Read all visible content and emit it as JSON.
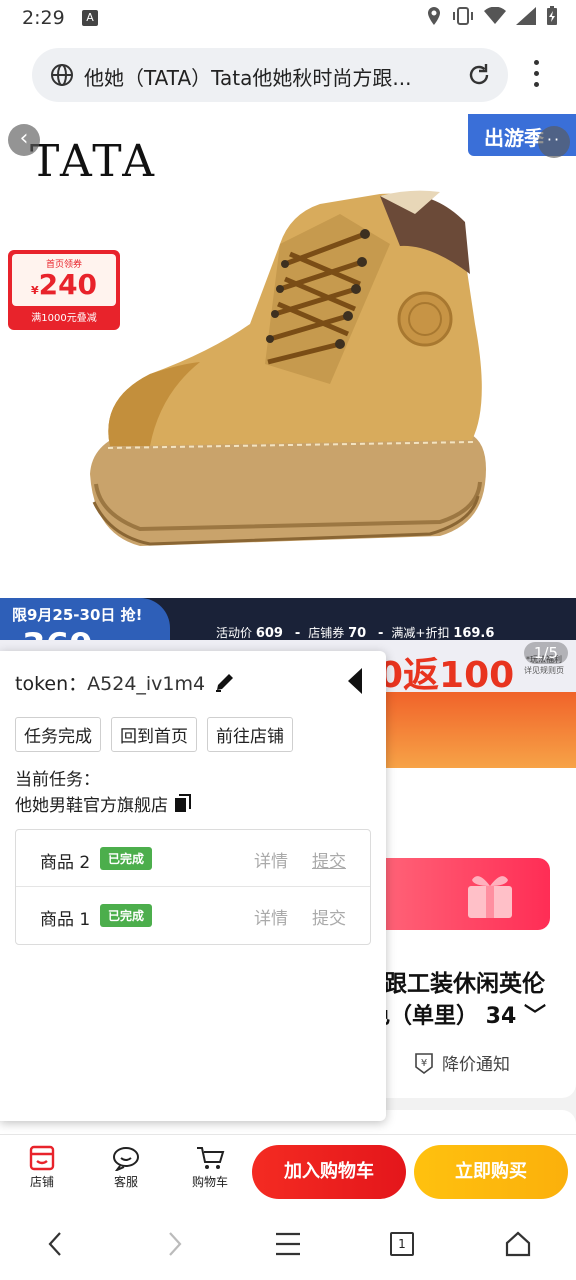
{
  "status_bar": {
    "time": "2:29",
    "a_badge": "A"
  },
  "browser": {
    "url_title": "他她（TATA）Tata他她秋时尚方跟..."
  },
  "hero": {
    "brand": "TATA",
    "corner_banner": "出游季",
    "coupon": {
      "title": "首页领券",
      "currency": "¥",
      "value": "240",
      "footer": "满1000元叠减"
    }
  },
  "promo": {
    "date": "限9月25-30日 抢!",
    "big_price": "369",
    "activity_label": "活动价",
    "activity_price": "609",
    "shop_coupon_label": "店铺券",
    "shop_coupon": "70",
    "discount_label": "满减+折扣",
    "discount": "169.6"
  },
  "banner": {
    "text": "0返100",
    "sub": "*玩法福利 详见规则页",
    "page_indicator": "1/5"
  },
  "product": {
    "title_line1": "跟工装休闲英伦",
    "title_line2": "色（单里） 34",
    "price_notify": "降价通知"
  },
  "panel": {
    "token_label": "token：",
    "token_value": "A524_iv1m4",
    "buttons": [
      "任务完成",
      "回到首页",
      "前往店铺"
    ],
    "current_task_label": "当前任务：",
    "shop_name": "他她男鞋官方旗舰店",
    "tasks": [
      {
        "name": "商品 2",
        "status": "已完成",
        "detail": "详情",
        "submit": "提交"
      },
      {
        "name": "商品 1",
        "status": "已完成",
        "detail": "详情",
        "submit": "提交"
      }
    ]
  },
  "action_bar": {
    "shop": "店铺",
    "service": "客服",
    "cart": "购物车",
    "add_to_cart": "加入购物车",
    "buy_now": "立即购买"
  },
  "system_nav": {
    "tab_count": "1"
  },
  "colors": {
    "accent_red": "#e8232b",
    "buy_yellow": "#ffc10e",
    "badge_green": "#4cae4c",
    "promo_blue": "#2e5fb8"
  }
}
